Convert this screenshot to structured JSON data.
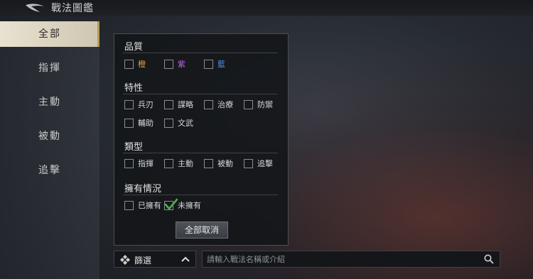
{
  "header": {
    "title": "戰法圖鑑"
  },
  "sidebar": {
    "items": [
      {
        "label": "全部",
        "active": true
      },
      {
        "label": "指揮",
        "active": false
      },
      {
        "label": "主動",
        "active": false
      },
      {
        "label": "被動",
        "active": false
      },
      {
        "label": "追擊",
        "active": false
      }
    ]
  },
  "filter_panel": {
    "quality": {
      "title": "品質",
      "options": [
        {
          "label": "橙",
          "checked": false,
          "color": "#e8a13a"
        },
        {
          "label": "紫",
          "checked": false,
          "color": "#b563e0"
        },
        {
          "label": "藍",
          "checked": false,
          "color": "#4a8fe0"
        }
      ]
    },
    "traits": {
      "title": "特性",
      "options": [
        {
          "label": "兵刃",
          "checked": false
        },
        {
          "label": "謀略",
          "checked": false
        },
        {
          "label": "治療",
          "checked": false
        },
        {
          "label": "防禦",
          "checked": false
        },
        {
          "label": "輔助",
          "checked": false
        },
        {
          "label": "文武",
          "checked": false
        }
      ]
    },
    "types": {
      "title": "類型",
      "options": [
        {
          "label": "指揮",
          "checked": false
        },
        {
          "label": "主動",
          "checked": false
        },
        {
          "label": "被動",
          "checked": false
        },
        {
          "label": "追擊",
          "checked": false
        }
      ]
    },
    "ownership": {
      "title": "擁有情況",
      "options": [
        {
          "label": "已擁有",
          "checked": false
        },
        {
          "label": "未擁有",
          "checked": true
        }
      ]
    },
    "clear_label": "全部取消"
  },
  "bottom_bar": {
    "filter_label": "篩選",
    "search_placeholder": "請輸入戰法名稱或介紹"
  },
  "colors": {
    "accent": "#b79a55",
    "check": "#4caf50"
  }
}
